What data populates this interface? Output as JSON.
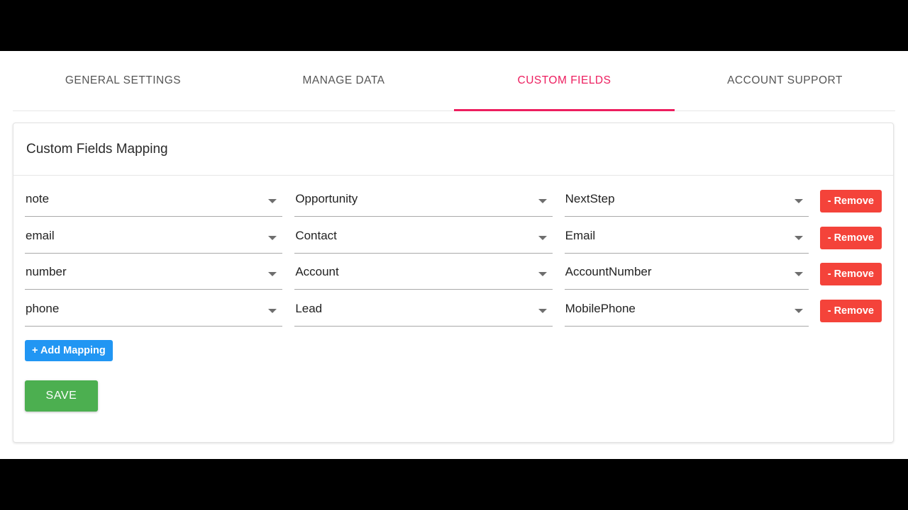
{
  "window": {
    "letterbox_color": "#000000",
    "page_background": "#ffffff"
  },
  "theme": {
    "accent_pink": "#ed1e5f",
    "remove_red": "#f4433a",
    "add_blue": "#2196f3",
    "save_green": "#4caf50",
    "tab_inactive_text": "#555555"
  },
  "tabs": {
    "active_index": 2,
    "items": [
      {
        "label": "GENERAL SETTINGS",
        "active": false
      },
      {
        "label": "MANAGE DATA",
        "active": false
      },
      {
        "label": "CUSTOM FIELDS",
        "active": true
      },
      {
        "label": "ACCOUNT SUPPORT",
        "active": false
      }
    ]
  },
  "card": {
    "title": "Custom Fields Mapping",
    "column_count": 3,
    "rows": [
      {
        "source_field": "note",
        "object_name": "Opportunity",
        "target_field": "NextStep",
        "remove_label": "- Remove"
      },
      {
        "source_field": "email",
        "object_name": "Contact",
        "target_field": "Email",
        "remove_label": "- Remove"
      },
      {
        "source_field": "number",
        "object_name": "Account",
        "target_field": "AccountNumber",
        "remove_label": "- Remove"
      },
      {
        "source_field": "phone",
        "object_name": "Lead",
        "target_field": "MobilePhone",
        "remove_label": "- Remove"
      }
    ],
    "add_mapping_label": "+ Add Mapping",
    "save_label": "SAVE"
  },
  "icons": {
    "dropdown": "chevron-down-icon"
  }
}
